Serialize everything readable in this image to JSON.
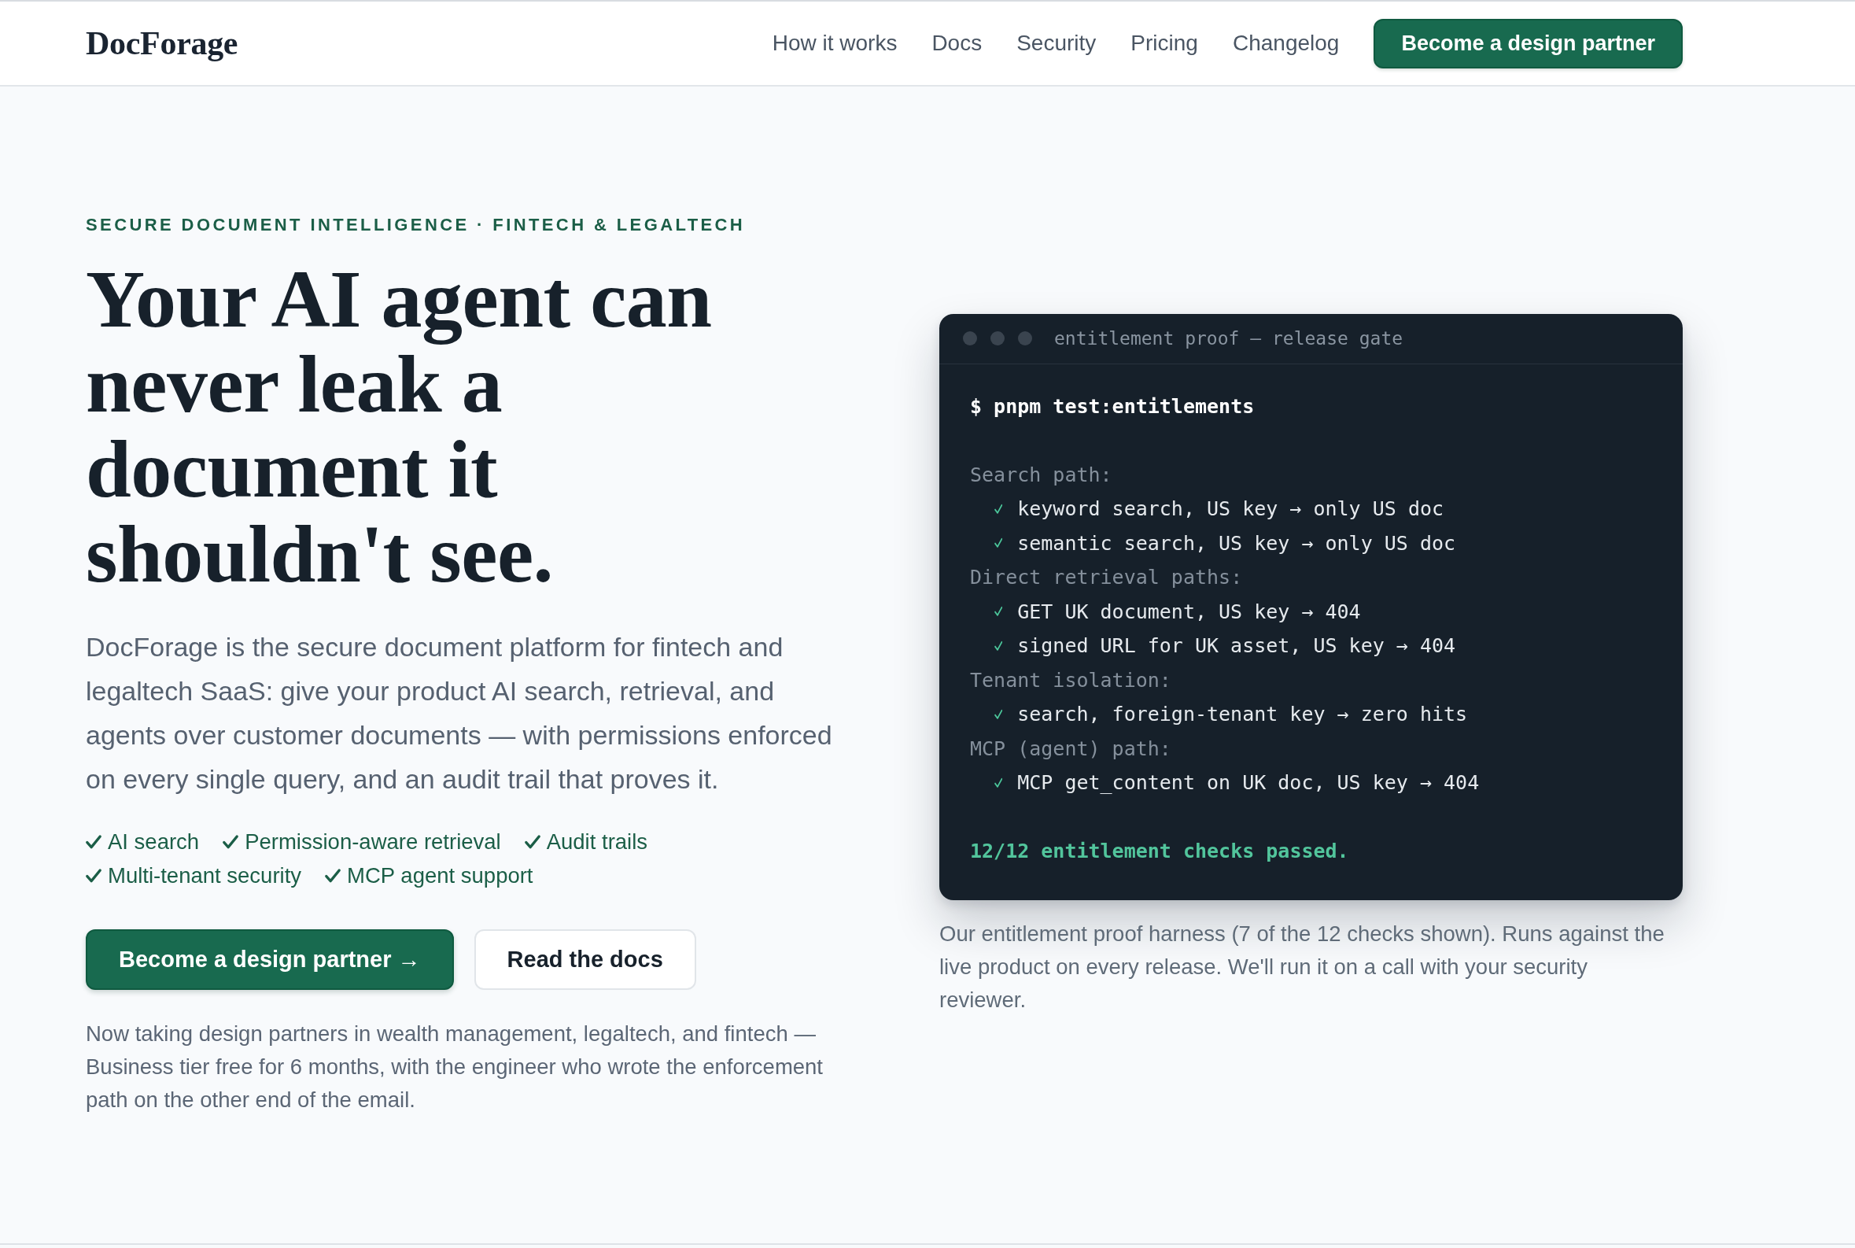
{
  "header": {
    "logo": "DocForage",
    "nav": [
      "How it works",
      "Docs",
      "Security",
      "Pricing",
      "Changelog"
    ],
    "cta": "Become a design partner"
  },
  "hero": {
    "eyebrow": "SECURE DOCUMENT INTELLIGENCE · FINTECH & LEGALTECH",
    "heading": "Your AI agent can never leak a document it shouldn't see.",
    "lead": "DocForage is the secure document platform for fintech and legaltech SaaS: give your product AI search, retrieval, and agents over customer documents — with permissions enforced on every single query, and an audit trail that proves it.",
    "features": [
      "AI search",
      "Permission-aware retrieval",
      "Audit trails",
      "Multi-tenant security",
      "MCP agent support"
    ],
    "buttons": [
      {
        "label": "Become a design partner →",
        "kind": "primary"
      },
      {
        "label": "Read the docs",
        "kind": "secondary"
      }
    ],
    "note": "Now taking design partners in wealth management, legaltech, and fintech — Business tier free for 6 months, with the engineer who wrote the enforcement path on the other end of the email."
  },
  "terminal": {
    "title": "entitlement proof — release gate",
    "command": "$ pnpm test:entitlements",
    "sections": [
      {
        "heading": "Search path:",
        "checks": [
          "keyword search, US key → only US doc",
          "semantic search, US key → only US doc"
        ]
      },
      {
        "heading": "Direct retrieval paths:",
        "checks": [
          "GET UK document, US key → 404",
          "signed URL for UK asset, US key → 404"
        ]
      },
      {
        "heading": "Tenant isolation:",
        "checks": [
          "search, foreign-tenant key → zero hits"
        ]
      },
      {
        "heading": "MCP (agent) path:",
        "checks": [
          "MCP get_content on UK doc, US key → 404"
        ]
      }
    ],
    "summary": "12/12 entitlement checks passed."
  },
  "caption": "Our entitlement proof harness (7 of the 12 checks shown). Runs against the live product on every release. We'll run it on a call with your security reviewer."
}
